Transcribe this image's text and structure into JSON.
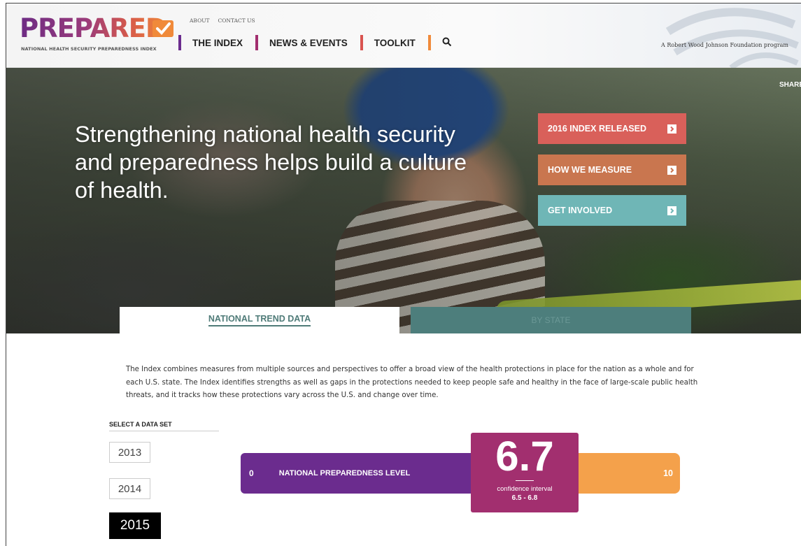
{
  "header": {
    "logo_text": "PREPARED",
    "logo_tagline": "NATIONAL HEALTH SECURITY PREPAREDNESS INDEX",
    "top_links": [
      "ABOUT",
      "CONTACT US"
    ],
    "nav": [
      {
        "label": "THE INDEX",
        "color": "#6b2c8e"
      },
      {
        "label": "NEWS & EVENTS",
        "color": "#a22f6f"
      },
      {
        "label": "TOOLKIT",
        "color": "#d9534f"
      }
    ],
    "search_icon": "search-icon",
    "partner_text": "A Robert Wood Johnson Foundation program"
  },
  "hero": {
    "headline": "Strengthening national health security and preparedness helps build a culture of health.",
    "share_label": "SHARE",
    "cta": [
      {
        "label": "2016 INDEX RELEASED",
        "color": "#d9605a"
      },
      {
        "label": "HOW WE MEASURE",
        "color": "#c9764f"
      },
      {
        "label": "GET INVOLVED",
        "color": "#6fb6b6"
      }
    ]
  },
  "tabs": {
    "national": "NATIONAL TREND DATA",
    "state": "BY STATE"
  },
  "intro_text": "The Index combines measures from multiple sources and perspectives to offer a broad view of the health protections in place for the nation as a whole and for each U.S. state. The Index identifies strengths as well as gaps in the protections needed to keep people safe and healthy in the face of large-scale public health threats, and it tracks how these protections vary across the U.S. and change over time.",
  "data_set": {
    "label": "SELECT A DATA SET",
    "years": [
      "2013",
      "2014",
      "2015"
    ],
    "selected": "2015"
  },
  "gauge": {
    "min": "0",
    "max": "10",
    "label": "NATIONAL PREPAREDNESS LEVEL",
    "score": "6.7",
    "ci_label": "confidence interval",
    "ci": "6.5 - 6.8",
    "colors": {
      "left": "#6b2c8e",
      "score": "#a22f6f",
      "right": "#f4a14b"
    }
  }
}
